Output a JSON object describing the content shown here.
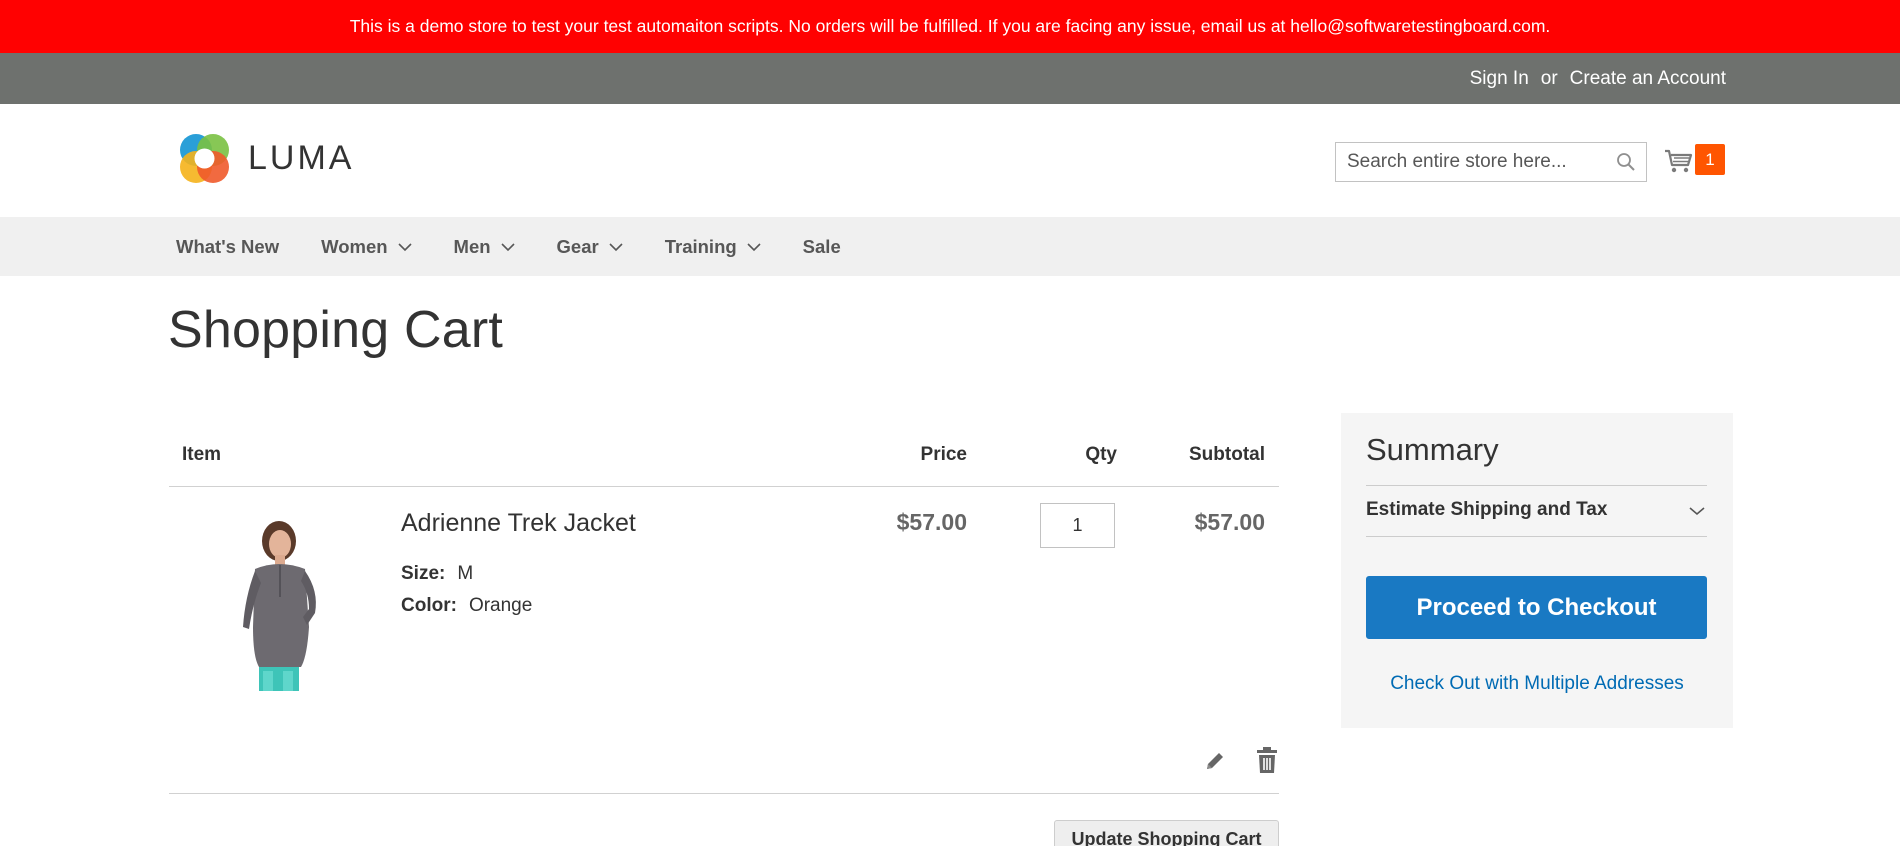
{
  "banner": {
    "text": "This is a demo store to test your test automaiton scripts. No orders will be fulfilled. If you are facing any issue, email us at hello@softwaretestingboard.com."
  },
  "header": {
    "sign_in": "Sign In",
    "or": "or",
    "create_account": "Create an Account",
    "logo_text": "LUMA",
    "search_placeholder": "Search entire store here...",
    "cart_count": "1",
    "colors": {
      "banner": "#ff0101",
      "topbar": "#6e716e",
      "cart_badge": "#ff5501"
    }
  },
  "nav": {
    "items": [
      {
        "label": "What's New",
        "has_dropdown": false
      },
      {
        "label": "Women",
        "has_dropdown": true
      },
      {
        "label": "Men",
        "has_dropdown": true
      },
      {
        "label": "Gear",
        "has_dropdown": true
      },
      {
        "label": "Training",
        "has_dropdown": true
      },
      {
        "label": "Sale",
        "has_dropdown": false
      }
    ]
  },
  "page": {
    "title": "Shopping Cart"
  },
  "cart": {
    "columns": {
      "item": "Item",
      "price": "Price",
      "qty": "Qty",
      "subtotal": "Subtotal"
    },
    "items": [
      {
        "name": "Adrienne Trek Jacket",
        "size_label": "Size:",
        "size": "M",
        "color_label": "Color:",
        "color": "Orange",
        "price": "$57.00",
        "qty": "1",
        "subtotal": "$57.00"
      }
    ],
    "update_button": "Update Shopping Cart"
  },
  "summary": {
    "title": "Summary",
    "estimate_label": "Estimate Shipping and Tax",
    "checkout_button": "Proceed to Checkout",
    "multi_address_link": "Check Out with Multiple Addresses",
    "accent_color": "#1979c3"
  },
  "icons": [
    "search-icon",
    "cart-icon",
    "chevron-down-icon",
    "edit-pencil-icon",
    "trash-icon"
  ]
}
